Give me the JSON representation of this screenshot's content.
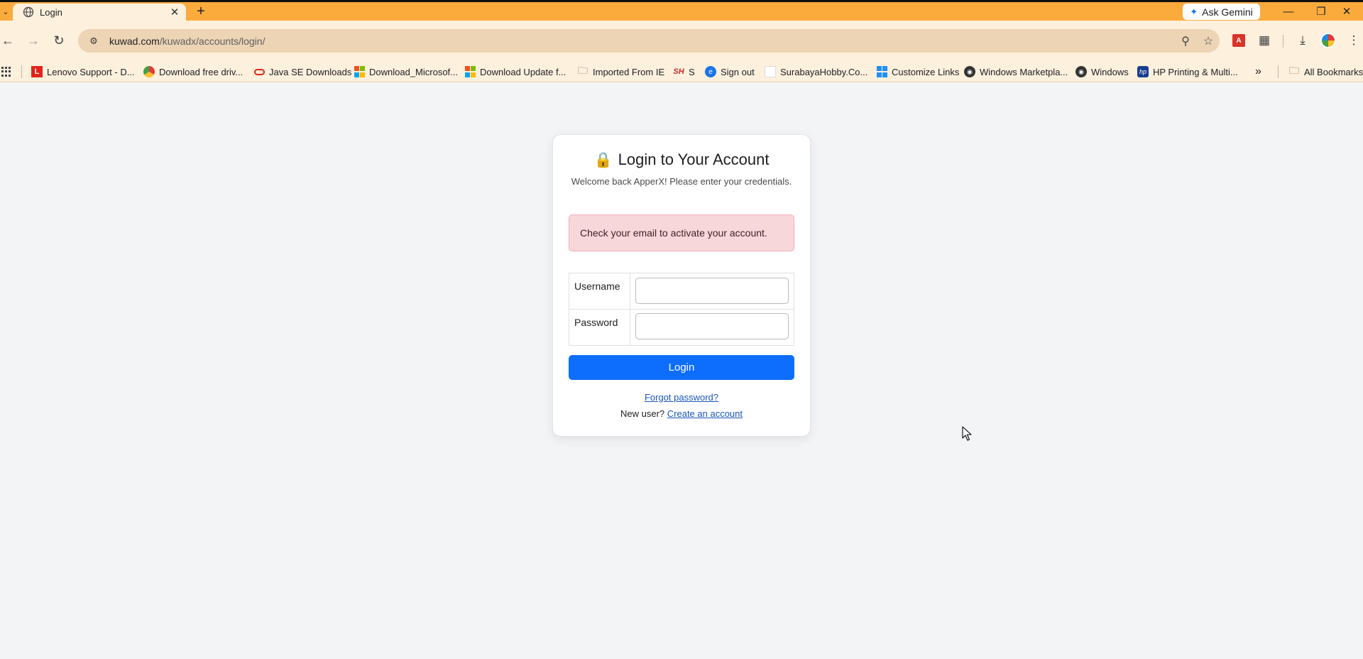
{
  "browser": {
    "tab": {
      "title": "Login"
    },
    "gemini_label": "Ask Gemini",
    "url_host": "kuwad.com",
    "url_path": "/kuwadx/accounts/login/",
    "bookmarks": [
      {
        "label": "Lenovo Support - D..."
      },
      {
        "label": "Download free driv..."
      },
      {
        "label": "Java SE Downloads"
      },
      {
        "label": "Download_Microsof..."
      },
      {
        "label": "Download Update f..."
      },
      {
        "label": "Imported From IE"
      },
      {
        "label": "S"
      },
      {
        "label": "Sign out"
      },
      {
        "label": "SurabayaHobby.Co..."
      },
      {
        "label": "Customize Links"
      },
      {
        "label": "Windows Marketpla..."
      },
      {
        "label": "Windows"
      },
      {
        "label": "HP Printing & Multi..."
      }
    ],
    "all_bookmarks_label": "All Bookmarks",
    "accent_color": "#fbab3c"
  },
  "login": {
    "title": "Login to Your Account",
    "subtitle": "Welcome back ApperX! Please enter your credentials.",
    "alert": "Check your email to activate your account.",
    "username_label": "Username",
    "username_value": "",
    "password_label": "Password",
    "password_value": "",
    "button_label": "Login",
    "forgot_link": "Forgot password?",
    "new_user_text": "New user?",
    "create_link": "Create an account",
    "button_color": "#0d6efd",
    "alert_color": "#f8d7da"
  }
}
